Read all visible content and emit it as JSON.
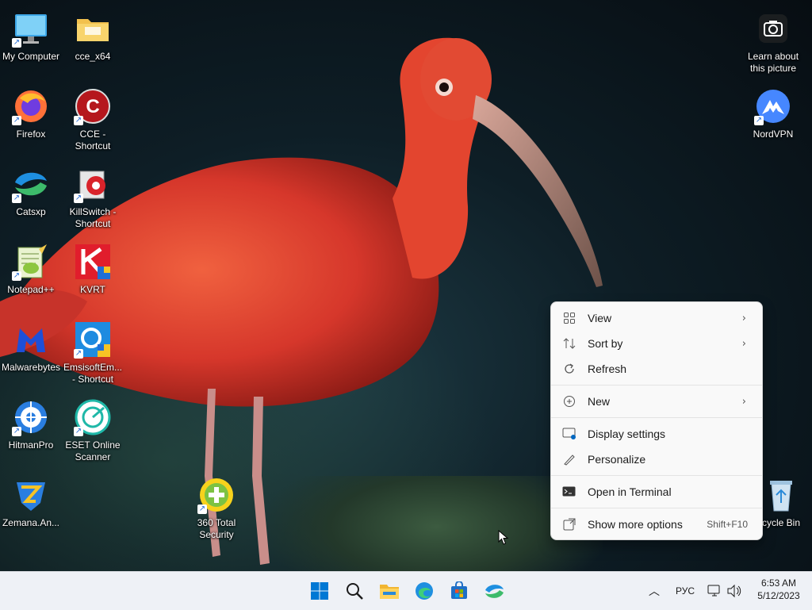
{
  "desktop": {
    "icons": [
      {
        "id": "my-computer",
        "label": "My Computer"
      },
      {
        "id": "cce-x64",
        "label": "cce_x64"
      },
      {
        "id": "firefox",
        "label": "Firefox"
      },
      {
        "id": "cce-shortcut",
        "label": "CCE - Shortcut"
      },
      {
        "id": "catsxp",
        "label": "Catsxp"
      },
      {
        "id": "killswitch",
        "label": "KillSwitch - Shortcut"
      },
      {
        "id": "notepadpp",
        "label": "Notepad++"
      },
      {
        "id": "kvrt",
        "label": "KVRT"
      },
      {
        "id": "malwarebytes",
        "label": "Malwarebytes"
      },
      {
        "id": "emsisoft",
        "label": "EmsisoftEm... - Shortcut"
      },
      {
        "id": "hitmanpro",
        "label": "HitmanPro"
      },
      {
        "id": "eset",
        "label": "ESET Online Scanner"
      },
      {
        "id": "zemana",
        "label": "Zemana.An..."
      },
      {
        "id": "360",
        "label": "360 Total Security"
      },
      {
        "id": "learn",
        "label": "Learn about this picture"
      },
      {
        "id": "nordvpn",
        "label": "NordVPN"
      },
      {
        "id": "recycle",
        "label": "cycle Bin"
      }
    ]
  },
  "context_menu": {
    "items": [
      {
        "label": "View",
        "icon": "grid-icon",
        "submenu": true
      },
      {
        "label": "Sort by",
        "icon": "sort-icon",
        "submenu": true
      },
      {
        "label": "Refresh",
        "icon": "refresh-icon",
        "submenu": false
      },
      {
        "label": "New",
        "icon": "plus-circle-icon",
        "submenu": true
      },
      {
        "label": "Display settings",
        "icon": "display-icon",
        "submenu": false
      },
      {
        "label": "Personalize",
        "icon": "brush-icon",
        "submenu": false
      },
      {
        "label": "Open in Terminal",
        "icon": "terminal-icon",
        "submenu": false
      },
      {
        "label": "Show more options",
        "icon": "more-options-icon",
        "submenu": false,
        "shortcut": "Shift+F10"
      }
    ]
  },
  "taskbar": {
    "apps": [
      "start-icon",
      "search-icon",
      "file-explorer-icon",
      "edge-icon",
      "store-icon",
      "catsxp-icon"
    ],
    "tray": {
      "language": "РУС",
      "time": "6:53 AM",
      "date": "5/12/2023"
    }
  },
  "colors": {
    "accent": "#0067c0",
    "taskbar_bg": "#eef1f6",
    "menu_bg": "#f9f9f9"
  }
}
